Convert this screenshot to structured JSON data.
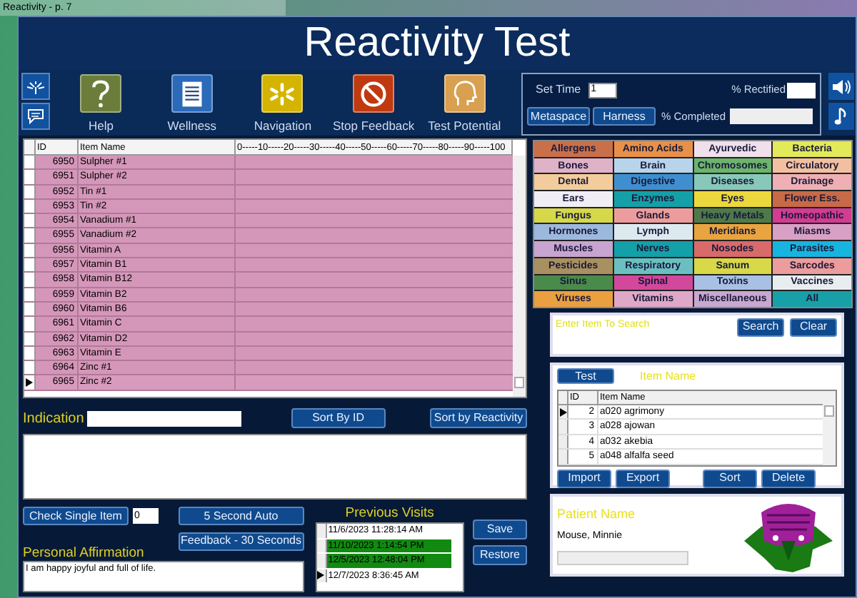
{
  "window": {
    "title": "Reactivity - p. 7"
  },
  "header": {
    "title": "Reactivity Test"
  },
  "toolbar": [
    {
      "label": "Help",
      "kind": "help"
    },
    {
      "label": "Wellness",
      "kind": "wellness"
    },
    {
      "label": "Navigation",
      "kind": "navigation"
    },
    {
      "label": "Stop Feedback",
      "kind": "stop"
    },
    {
      "label": "Test Potential",
      "kind": "potential"
    }
  ],
  "settings": {
    "set_time_label": "Set Time",
    "set_time_value": "1",
    "rectified_label": "% Rectified",
    "completed_label": "% Completed",
    "buttons": [
      "Metaspace",
      "Harness"
    ]
  },
  "items_table": {
    "columns": [
      "ID",
      "Item Name",
      "0-----10-----20-----30-----40-----50-----60-----70-----80-----90-----100"
    ],
    "rows": [
      {
        "id": "6950",
        "name": "Sulpher #1",
        "current": false
      },
      {
        "id": "6951",
        "name": "Sulpher #2",
        "current": false
      },
      {
        "id": "6952",
        "name": "Tin #1",
        "current": false
      },
      {
        "id": "6953",
        "name": "Tin #2",
        "current": false
      },
      {
        "id": "6954",
        "name": "Vanadium #1",
        "current": false
      },
      {
        "id": "6955",
        "name": "Vanadium #2",
        "current": false
      },
      {
        "id": "6956",
        "name": "Vitamin A",
        "current": false
      },
      {
        "id": "6957",
        "name": "Vitamin B1",
        "current": false
      },
      {
        "id": "6958",
        "name": "Vitamin B12",
        "current": false
      },
      {
        "id": "6959",
        "name": "Vitamin B2",
        "current": false
      },
      {
        "id": "6960",
        "name": "Vitamin B6",
        "current": false
      },
      {
        "id": "6961",
        "name": "Vitamin C",
        "current": false
      },
      {
        "id": "6962",
        "name": "Vitamin D2",
        "current": false
      },
      {
        "id": "6963",
        "name": "Vitamin E",
        "current": false
      },
      {
        "id": "6964",
        "name": "Zinc #1",
        "current": false
      },
      {
        "id": "6965",
        "name": "Zinc #2",
        "current": true
      }
    ]
  },
  "indication": {
    "label": "Indication",
    "sort_buttons": [
      "Sort By ID",
      "Sort by Reactivity"
    ]
  },
  "controls": {
    "check_single": "Check Single Item",
    "check_value": "0",
    "auto": "5 Second Auto",
    "feedback": "Feedback - 30 Seconds"
  },
  "affirmation": {
    "label": "Personal Affirmation",
    "text": "I am happy joyful and full of life."
  },
  "previous_visits": {
    "title": "Previous Visits",
    "rows": [
      {
        "date": "11/6/2023 11:28:14 AM",
        "highlighted": false,
        "current": false
      },
      {
        "date": "11/10/2023 1:14:54 PM",
        "highlighted": true,
        "current": false
      },
      {
        "date": "12/5/2023 12:48:04 PM",
        "highlighted": true,
        "current": false
      },
      {
        "date": "12/7/2023 8:36:45 AM",
        "highlighted": false,
        "current": true
      }
    ],
    "buttons": [
      "Save",
      "Restore"
    ]
  },
  "categories": [
    {
      "label": "Allergens",
      "color": "#c9704a"
    },
    {
      "label": "Amino Acids",
      "color": "#e8904a"
    },
    {
      "label": "Ayurvedic",
      "color": "#efe0ec"
    },
    {
      "label": "Bacteria",
      "color": "#e2ea5a"
    },
    {
      "label": "Bones",
      "color": "#e0b2c8"
    },
    {
      "label": "Brain",
      "color": "#b8d4ea"
    },
    {
      "label": "Chromosomes",
      "color": "#6cb46c"
    },
    {
      "label": "Circulatory",
      "color": "#f2c0a0"
    },
    {
      "label": "Dental",
      "color": "#f2cc9c"
    },
    {
      "label": "Digestive",
      "color": "#3f8fd0"
    },
    {
      "label": "Diseases",
      "color": "#88c8b8"
    },
    {
      "label": "Drainage",
      "color": "#eeb0b4"
    },
    {
      "label": "Ears",
      "color": "#f0eef4"
    },
    {
      "label": "Enzymes",
      "color": "#14a0a8"
    },
    {
      "label": "Eyes",
      "color": "#ecd83c"
    },
    {
      "label": "Flower Ess.",
      "color": "#c86a48"
    },
    {
      "label": "Fungus",
      "color": "#d6d84a"
    },
    {
      "label": "Glands",
      "color": "#ec9c9c"
    },
    {
      "label": "Heavy Metals",
      "color": "#4e7a4a"
    },
    {
      "label": "Homeopathic",
      "color": "#d23c92"
    },
    {
      "label": "Hormones",
      "color": "#9cb8dc"
    },
    {
      "label": "Lymph",
      "color": "#dceaf0"
    },
    {
      "label": "Meridians",
      "color": "#e8a440"
    },
    {
      "label": "Miasms",
      "color": "#d8a0c4"
    },
    {
      "label": "Muscles",
      "color": "#c8a4d0"
    },
    {
      "label": "Nerves",
      "color": "#14a0a8"
    },
    {
      "label": "Nosodes",
      "color": "#d86a6a"
    },
    {
      "label": "Parasites",
      "color": "#18b4e0"
    },
    {
      "label": "Pesticides",
      "color": "#a89060"
    },
    {
      "label": "Respiratory",
      "color": "#6ac0c0"
    },
    {
      "label": "Sanum",
      "color": "#d8d848"
    },
    {
      "label": "Sarcodes",
      "color": "#ec9c9c"
    },
    {
      "label": "Sinus",
      "color": "#4a8a4a"
    },
    {
      "label": "Spinal",
      "color": "#d2489c"
    },
    {
      "label": "Toxins",
      "color": "#a8c0e4"
    },
    {
      "label": "Vaccines",
      "color": "#e8eef0"
    },
    {
      "label": "Viruses",
      "color": "#eaa040"
    },
    {
      "label": "Vitamins",
      "color": "#e0a8c8"
    },
    {
      "label": "Miscellaneous",
      "color": "#c8a8d0"
    },
    {
      "label": "All",
      "color": "#18a0a8"
    }
  ],
  "search": {
    "placeholder": "Enter Item To Search",
    "buttons": [
      "Search",
      "Clear"
    ]
  },
  "test_panel": {
    "button": "Test",
    "heading": "Item Name",
    "columns": [
      "ID",
      "Item Name"
    ],
    "rows": [
      {
        "id": "2",
        "name": "a020 agrimony",
        "current": true
      },
      {
        "id": "3",
        "name": "a028 ajowan",
        "current": false
      },
      {
        "id": "4",
        "name": "a032 akebia",
        "current": false
      },
      {
        "id": "5",
        "name": "a048 alfalfa seed",
        "current": false
      }
    ],
    "buttons": [
      "Import",
      "Export",
      "Sort",
      "Delete"
    ]
  },
  "patient": {
    "label": "Patient Name",
    "name": "Mouse, Minnie",
    "kind": "picture"
  }
}
